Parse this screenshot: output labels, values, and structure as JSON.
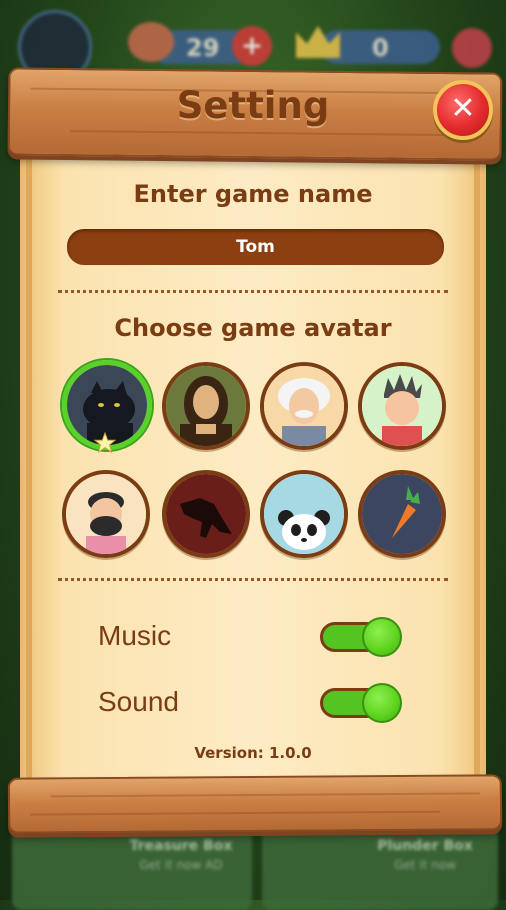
{
  "hud": {
    "meat_count": "29",
    "crown_count": "0"
  },
  "background": {
    "treasure_box_title": "Treasure Box",
    "treasure_box_sub": "Get it now AD",
    "plunder_box_title": "Plunder Box",
    "plunder_box_sub": "Get it now"
  },
  "dialog": {
    "title": "Setting",
    "close_icon": "close-x-icon",
    "name_heading": "Enter game name",
    "name_value": "Tom",
    "avatar_heading": "Choose game avatar",
    "avatars": [
      {
        "name": "panther",
        "selected": true
      },
      {
        "name": "mona-lisa",
        "selected": false
      },
      {
        "name": "einstein",
        "selected": false
      },
      {
        "name": "spiky-boy",
        "selected": false
      },
      {
        "name": "bearded-man",
        "selected": false
      },
      {
        "name": "t-rex",
        "selected": false
      },
      {
        "name": "panda",
        "selected": false
      },
      {
        "name": "carrot",
        "selected": false
      }
    ],
    "music_label": "Music",
    "music_on": true,
    "sound_label": "Sound",
    "sound_on": true,
    "version": "Version: 1.0.0"
  },
  "colors": {
    "wood": "#c97f44",
    "text_brown": "#7a3c12",
    "toggle_on": "#55c423",
    "close_red": "#e32b2b",
    "selected_ring": "#58d12a"
  }
}
